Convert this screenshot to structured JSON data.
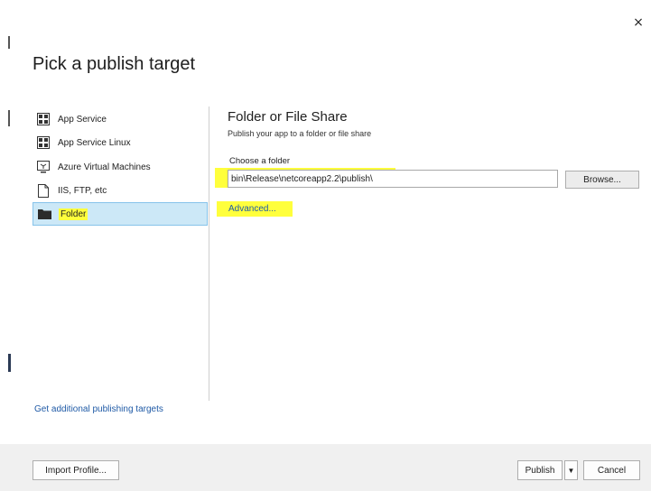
{
  "dialog": {
    "title": "Pick a publish target",
    "close_glyph": "×"
  },
  "targets": [
    {
      "label": "App Service",
      "icon": "app-service-icon",
      "selected": false
    },
    {
      "label": "App Service Linux",
      "icon": "app-service-linux-icon",
      "selected": false
    },
    {
      "label": "Azure Virtual Machines",
      "icon": "virtual-machine-icon",
      "selected": false
    },
    {
      "label": "IIS, FTP, etc",
      "icon": "document-icon",
      "selected": false
    },
    {
      "label": "Folder",
      "icon": "folder-icon",
      "selected": true
    }
  ],
  "more_targets_link": "Get additional publishing targets",
  "panel": {
    "title": "Folder or File Share",
    "subtitle": "Publish your app to a folder or file share",
    "folder_label": "Choose a folder",
    "folder_value": "bin\\Release\\netcoreapp2.2\\publish\\",
    "browse_label": "Browse...",
    "advanced_link": "Advanced..."
  },
  "footer": {
    "import_label": "Import Profile...",
    "publish_label": "Publish",
    "publish_dropdown_glyph": "▼",
    "cancel_label": "Cancel"
  },
  "colors": {
    "highlight": "#ffff3c",
    "selection": "#cce8f7",
    "link": "#1f5aa6"
  }
}
